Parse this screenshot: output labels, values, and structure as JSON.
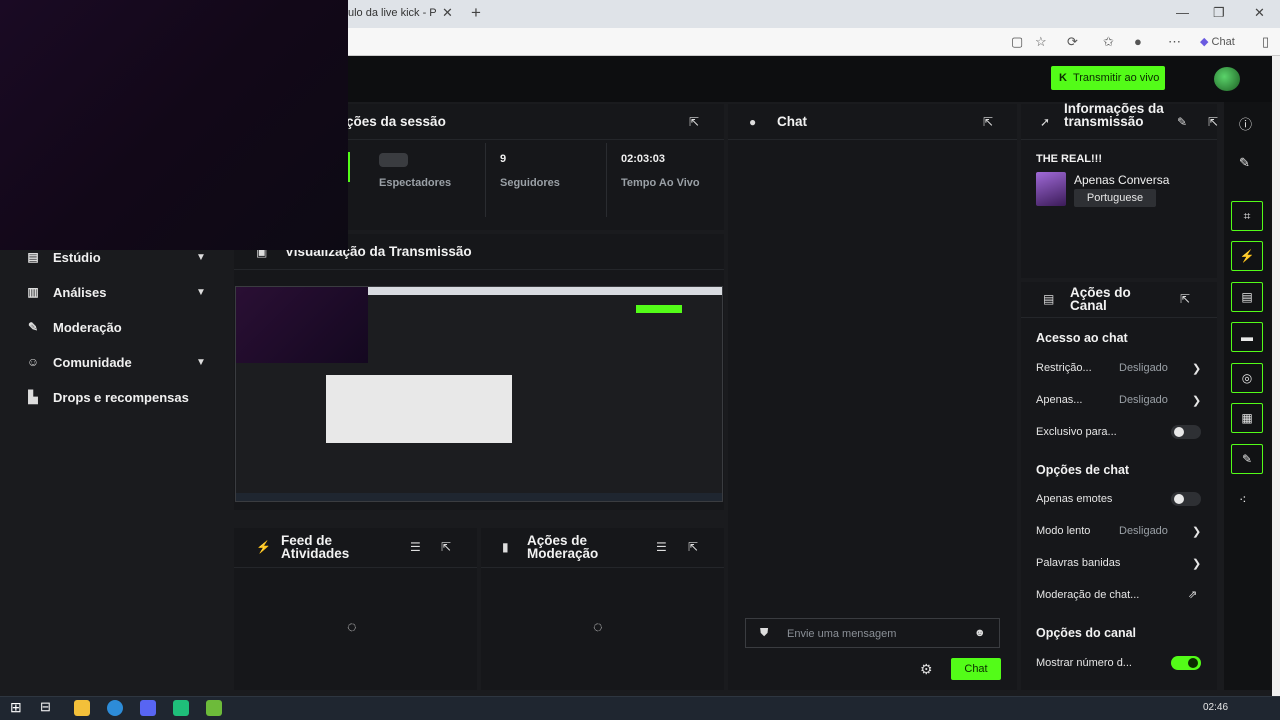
{
  "browser": {
    "tab_title": "ulo da live kick - P",
    "chat_label": "Chat"
  },
  "header": {
    "go_live_label": "Transmitir ao vivo",
    "go_live_logo": "K"
  },
  "sidebar": {
    "items": [
      {
        "label": "Estúdio",
        "icon": "studio-icon",
        "has_chevron": true
      },
      {
        "label": "Análises",
        "icon": "chart-icon",
        "has_chevron": true
      },
      {
        "label": "Moderação",
        "icon": "wrench-icon",
        "has_chevron": false
      },
      {
        "label": "Comunidade",
        "icon": "community-icon",
        "has_chevron": true
      },
      {
        "label": "Drops e recompensas",
        "icon": "drops-icon",
        "has_chevron": false
      }
    ]
  },
  "session": {
    "title": "ções da sessão",
    "stats": [
      {
        "label": "Espectadores",
        "value": ""
      },
      {
        "label": "Seguidores",
        "value": "9"
      },
      {
        "label": "Tempo Ao Vivo",
        "value": "02:03:03"
      }
    ]
  },
  "preview": {
    "title": "Visualização da Transmissão"
  },
  "activity": {
    "title": "Feed de Atividades"
  },
  "mod_actions": {
    "title": "Ações de Moderação"
  },
  "chat": {
    "title": "Chat",
    "placeholder": "Envie uma mensagem",
    "send_label": "Chat"
  },
  "stream_info": {
    "title": "Informações da transmissão",
    "stream_title": "THE REAL!!!",
    "category": "Apenas Conversa",
    "language": "Portuguese"
  },
  "channel_actions": {
    "title": "Ações do Canal",
    "chat_access": {
      "heading": "Acesso ao chat",
      "rows": [
        {
          "label": "Restrição...",
          "value": "Desligado",
          "type": "arrow"
        },
        {
          "label": "Apenas...",
          "value": "Desligado",
          "type": "arrow"
        },
        {
          "label": "Exclusivo para...",
          "value": "",
          "type": "toggle",
          "on": false
        }
      ]
    },
    "chat_options": {
      "heading": "Opções de chat",
      "rows": [
        {
          "label": "Apenas emotes",
          "value": "",
          "type": "toggle",
          "on": false
        },
        {
          "label": "Modo lento",
          "value": "Desligado",
          "type": "arrow"
        },
        {
          "label": "Palavras banidas",
          "value": "",
          "type": "arrow"
        },
        {
          "label": "Moderação de chat...",
          "value": "",
          "type": "link"
        }
      ]
    },
    "channel_options": {
      "heading": "Opções do canal",
      "rows": [
        {
          "label": "Mostrar número d...",
          "value": "",
          "type": "toggle",
          "on": true
        }
      ]
    }
  },
  "taskbar": {
    "time": "02:46"
  },
  "colors": {
    "accent": "#53fc18",
    "background": "#1a1b1e",
    "panel": "#16171a"
  }
}
